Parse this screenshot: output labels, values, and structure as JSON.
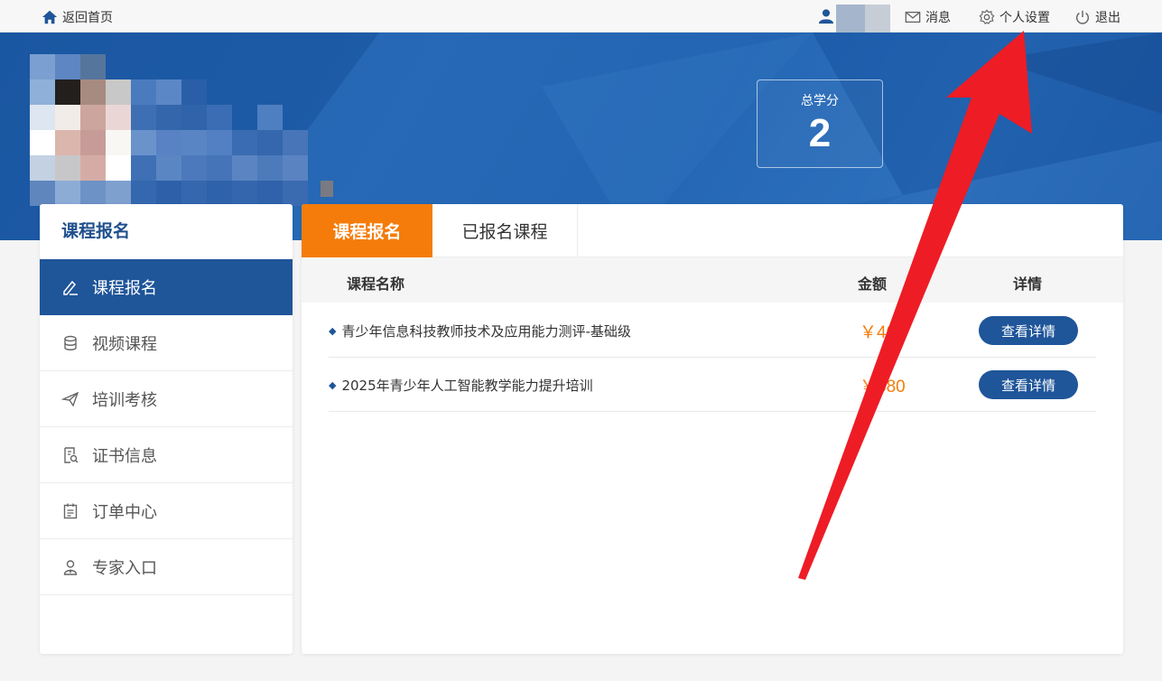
{
  "topbar": {
    "home_label": "返回首页",
    "messages_label": "消息",
    "settings_label": "个人设置",
    "logout_label": "退出"
  },
  "banner": {
    "credits_label": "总学分",
    "credits_value": "2"
  },
  "sidebar": {
    "title": "课程报名",
    "items": [
      {
        "label": "课程报名",
        "icon": "pen-icon",
        "active": true
      },
      {
        "label": "视频课程",
        "icon": "database-icon",
        "active": false
      },
      {
        "label": "培训考核",
        "icon": "paper-plane-icon",
        "active": false
      },
      {
        "label": "证书信息",
        "icon": "document-search-icon",
        "active": false
      },
      {
        "label": "订单中心",
        "icon": "calendar-list-icon",
        "active": false
      },
      {
        "label": "专家入口",
        "icon": "expert-icon",
        "active": false
      }
    ]
  },
  "main": {
    "tabs": [
      {
        "label": "课程报名",
        "active": true
      },
      {
        "label": "已报名课程",
        "active": false
      }
    ],
    "columns": {
      "name": "课程名称",
      "price": "金额",
      "detail": "详情"
    },
    "rows": [
      {
        "name": "青少年信息科技教师技术及应用能力测评-基础级",
        "price": "￥40",
        "button": "查看详情"
      },
      {
        "name": "2025年青少年人工智能教学能力提升培训",
        "price": "￥380",
        "button": "查看详情"
      }
    ]
  },
  "colors": {
    "brand_blue": "#1f5599",
    "accent_orange": "#f57c0a",
    "annotation_red": "#ee1c25"
  }
}
